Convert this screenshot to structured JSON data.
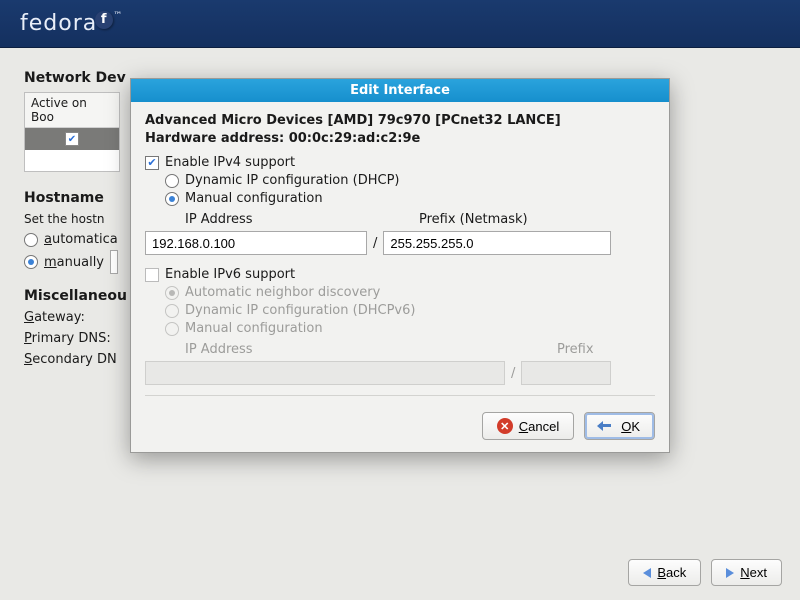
{
  "topbar": {
    "logo_text": "fedora"
  },
  "page": {
    "net_dev_heading": "Network Dev",
    "table": {
      "col1": "Active on Boo",
      "row_checked": true
    },
    "hostname_heading": "Hostname",
    "hostname_desc": "Set the hostn",
    "hostname_auto": "automatica",
    "hostname_manual": "manually",
    "hostname_manual_selected": true,
    "misc_heading": "Miscellaneou",
    "gateway_label": "Gateway:",
    "primary_dns_label": "Primary DNS:",
    "secondary_dns_label": "Secondary DN"
  },
  "modal": {
    "title": "Edit Interface",
    "device_line1": "Advanced Micro Devices [AMD] 79c970 [PCnet32 LANCE]",
    "device_line2": "Hardware address: 00:0c:29:ad:c2:9e",
    "ipv4": {
      "enable_label": "Enable IPv4 support",
      "enabled": true,
      "dhcp_label": "Dynamic IP configuration (DHCP)",
      "manual_label": "Manual configuration",
      "manual_selected": true,
      "ip_label": "IP Address",
      "prefix_label": "Prefix (Netmask)",
      "ip_value": "192.168.0.100",
      "prefix_value": "255.255.255.0",
      "slash": "/"
    },
    "ipv6": {
      "enable_label": "Enable IPv6 support",
      "enabled": false,
      "auto_label": "Automatic neighbor discovery",
      "dhcp_label": "Dynamic IP configuration (DHCPv6)",
      "manual_label": "Manual configuration",
      "ip_label": "IP Address",
      "prefix_label": "Prefix",
      "slash": "/"
    },
    "cancel_label": "Cancel",
    "ok_label": "OK"
  },
  "bottom": {
    "back_label": "Back",
    "next_label": "Next"
  }
}
